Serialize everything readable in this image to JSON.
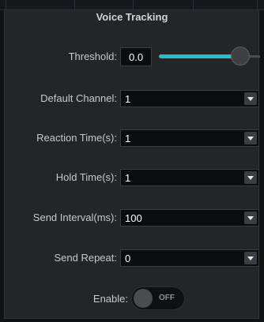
{
  "panel": {
    "title": "Voice Tracking"
  },
  "threshold": {
    "label": "Threshold:",
    "value": "0.0",
    "slider_level": 0.8
  },
  "default_channel": {
    "label": "Default Channel:",
    "value": "1"
  },
  "reaction_time": {
    "label": "Reaction Time(s):",
    "value": "1"
  },
  "hold_time": {
    "label": "Hold Time(s):",
    "value": "1"
  },
  "send_interval": {
    "label": "Send Interval(ms):",
    "value": "100"
  },
  "send_repeat": {
    "label": "Send Repeat:",
    "value": "0"
  },
  "enable": {
    "label": "Enable:",
    "state_text": "OFF"
  },
  "colors": {
    "accent": "#1fc3d0",
    "panel_bg": "#242527",
    "field_bg": "#0b0c0d"
  },
  "icons": {
    "dropdown": "chevron-down-icon"
  }
}
